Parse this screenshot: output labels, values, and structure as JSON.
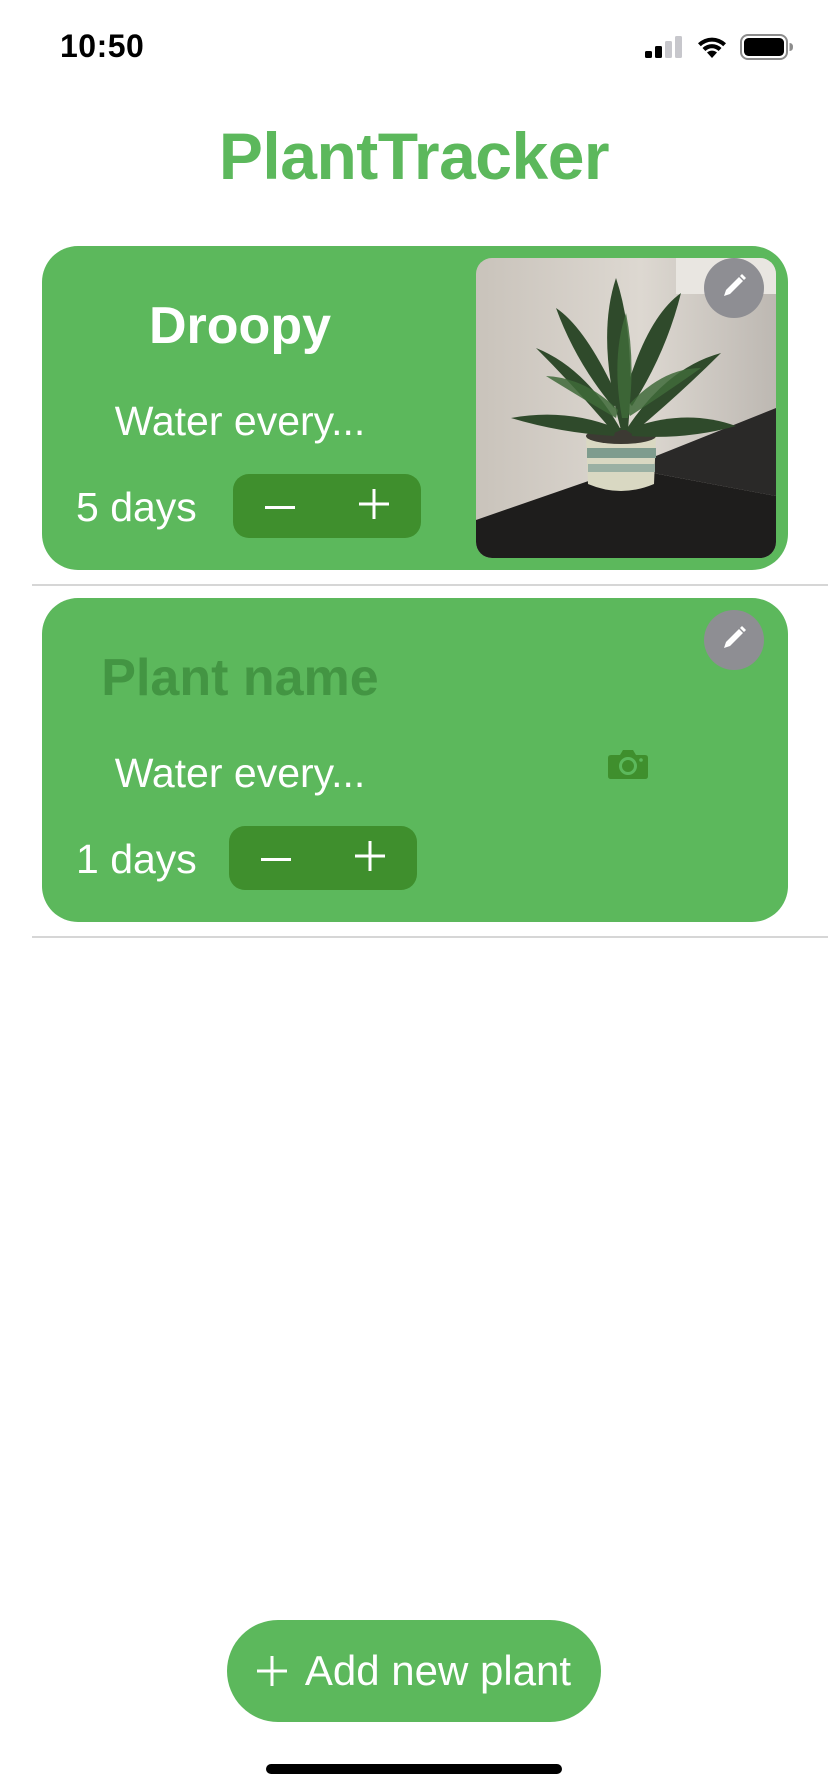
{
  "status_bar": {
    "time": "10:50",
    "icons": [
      "cellular-signal-icon",
      "wifi-icon",
      "battery-icon"
    ]
  },
  "app": {
    "title": "PlantTracker"
  },
  "colors": {
    "accent": "#5cb85c",
    "stepper_bg": "#3f8f2d",
    "edit_button": "#8e8e93",
    "divider": "#d6d6d6"
  },
  "plants": [
    {
      "name": "Droopy",
      "water_label": "Water every...",
      "days": "5 days",
      "stepper": {
        "decrement_icon": "minus-icon",
        "increment_icon": "plus-icon"
      },
      "has_photo": true,
      "photo_icon": "plant-photo",
      "edit_icon": "pencil-icon"
    },
    {
      "name_placeholder": "Plant name",
      "water_label": "Water every...",
      "days": "1 days",
      "stepper": {
        "decrement_icon": "minus-icon",
        "increment_icon": "plus-icon"
      },
      "has_photo": false,
      "photo_icon": "camera-icon",
      "edit_icon": "pencil-icon"
    }
  ],
  "add_button": {
    "label": "Add new plant",
    "icon": "plus-icon"
  }
}
